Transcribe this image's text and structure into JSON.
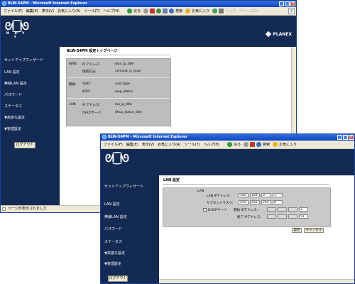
{
  "window1": {
    "title": "BLW-54PM - Microsoft Internet Explorer",
    "menu": [
      "ファイル(F)",
      "編集(E)",
      "表示(V)",
      "お気に入り(A)",
      "ツール(T)",
      "ヘルプ(H)"
    ],
    "toolbar": {
      "back": "戻る",
      "search": "検索",
      "favorites": "お気に入り",
      "links": "リンク",
      "address": "アドレス(D)"
    },
    "logo_word": "W A V E",
    "brand": "PLANEX",
    "nav": [
      "セットアップウィザード",
      "LAN 設定",
      "無線LAN 設定",
      "パスワード",
      "ステータス",
      "▼高度な設定",
      "▼管理設定"
    ],
    "logout": "ログアウト",
    "page_title": "BLW-54PM 設定トップページ",
    "status": {
      "wan": {
        "section": "WAN:",
        "rows": [
          {
            "key": "IP アドレス:",
            "val": "wan_ip_title"
          },
          {
            "key": "接続方法:",
            "val": "connect_is_type"
          }
        ]
      },
      "wireless": {
        "section": "無線:",
        "rows": [
          {
            "key": "SSID:",
            "val": "ssid_type"
          },
          {
            "key": "WEP:",
            "val": "wep_status"
          }
        ]
      },
      "lan": {
        "section": "LAN:",
        "rows": [
          {
            "key": "IP アドレス:",
            "val": "lan_ip_title"
          },
          {
            "key": "DHCPサーバ:",
            "val": "dhcp_status_title"
          }
        ]
      }
    },
    "statusbar": "ページが表示されました"
  },
  "window2": {
    "title": "BLW-54PM - Microsoft Internet Explorer",
    "menu": [
      "ファイル(F)",
      "編集(E)",
      "表示(V)",
      "お気に入り(A)",
      "ツール(T)",
      "ヘルプ(H)"
    ],
    "toolbar": {
      "back": "戻る",
      "search": "検索",
      "favorites": "お気に入り"
    },
    "nav": [
      "セットアップウィザード",
      "LAN 設定",
      "無線LAN 設定",
      "パスワード",
      "ステータス",
      "▼高度な設定",
      "▼管理設定"
    ],
    "logout": "ログアウト",
    "page_title": "LAN 設定",
    "form": {
      "section": "LAN",
      "ip_label": "LAN IPアドレス:",
      "ip": [
        "192",
        "168",
        "0",
        "1"
      ],
      "mask_label": "サブネットマスク:",
      "mask": [
        "255",
        "255",
        "255",
        "0"
      ],
      "dhcp_label": "DHCPサーバ",
      "start_label": "開始 IPアドレス:",
      "start_last": "2",
      "end_label": "終了 IPアドレス:",
      "end_last": "51",
      "set_button": "設定",
      "cancel_button": "キャンセル"
    }
  },
  "colors": {
    "navy": "#132a52",
    "titlebar": "#1046c0",
    "chrome": "#ece9d8",
    "panel": "#bdbdbd"
  }
}
